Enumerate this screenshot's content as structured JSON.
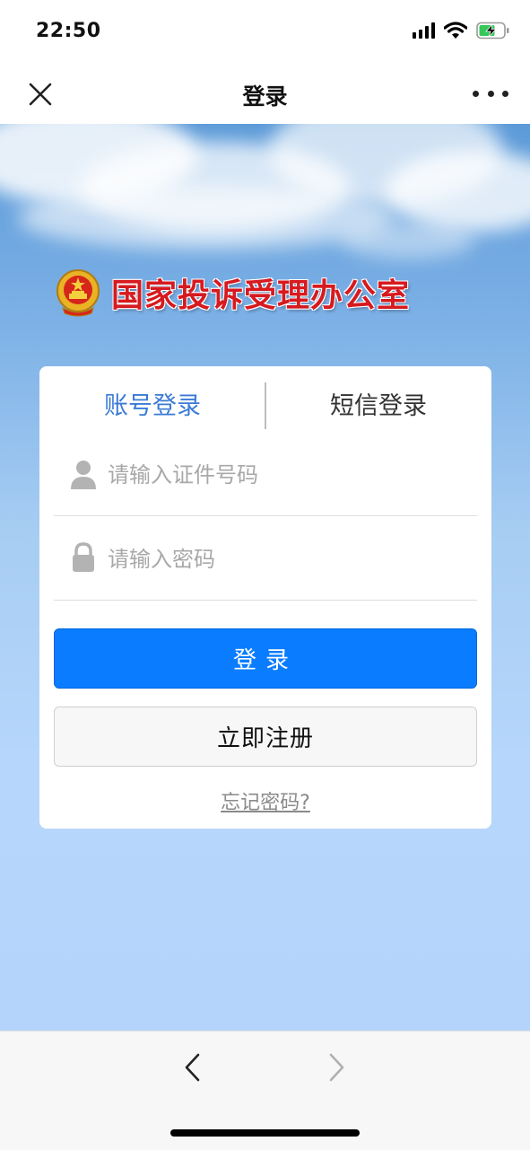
{
  "status_bar": {
    "time": "22:50",
    "icons": [
      "signal-icon",
      "wifi-icon",
      "battery-charging-icon"
    ],
    "battery_color": "#34c759"
  },
  "nav_bar": {
    "title": "登录",
    "close_icon": "close-icon",
    "more_icon": "more-icon"
  },
  "brand": {
    "org_name": "国家投诉受理办公室",
    "emblem_icon": "national-emblem-icon",
    "name_color": "#d61a1f"
  },
  "login": {
    "tabs": [
      {
        "label": "账号登录",
        "active": true
      },
      {
        "label": "短信登录",
        "active": false
      }
    ],
    "id_field": {
      "placeholder": "请输入证件号码",
      "value": "",
      "icon": "user-icon"
    },
    "password_field": {
      "placeholder": "请输入密码",
      "value": "",
      "icon": "lock-icon"
    },
    "login_button": "登录",
    "register_button": "立即注册",
    "forgot_link": "忘记密码?",
    "accent_color": "#0a7cff",
    "active_tab_color": "#3b7bd5"
  },
  "bottom_bar": {
    "back_icon": "chevron-left-icon",
    "forward_icon": "chevron-right-icon",
    "forward_enabled": false
  }
}
